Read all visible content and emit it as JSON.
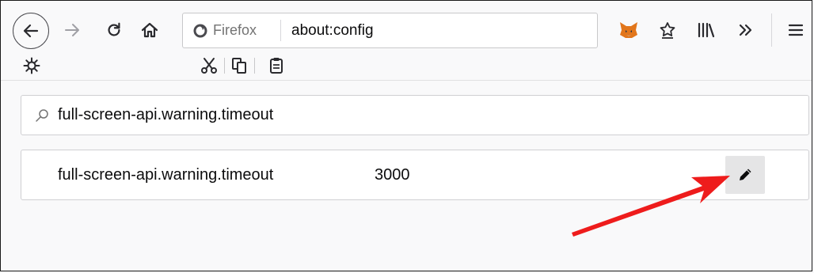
{
  "toolbar": {
    "icons": {
      "back": "back-arrow-icon",
      "forward": "forward-arrow-icon",
      "reload": "reload-icon",
      "home": "home-icon",
      "metamask": "metamask-fox-icon",
      "bookmark": "star-bookmark-icon",
      "library": "library-icon",
      "overflow": "chevron-double-right-icon",
      "menu": "hamburger-menu-icon",
      "customize": "gear-icon",
      "cut": "scissors-icon",
      "copy": "copy-icon",
      "paste": "paste-icon"
    }
  },
  "urlbar": {
    "identity_label": "Firefox",
    "url": "about:config"
  },
  "config": {
    "search_value": "full-screen-api.warning.timeout",
    "preference": {
      "name": "full-screen-api.warning.timeout",
      "value": "3000"
    }
  },
  "colors": {
    "background": "#f9f9fa",
    "annotation_arrow": "#ee1c1c",
    "firefox_logo": "#4a4a4f",
    "metamask_orange": "#e2761b"
  }
}
